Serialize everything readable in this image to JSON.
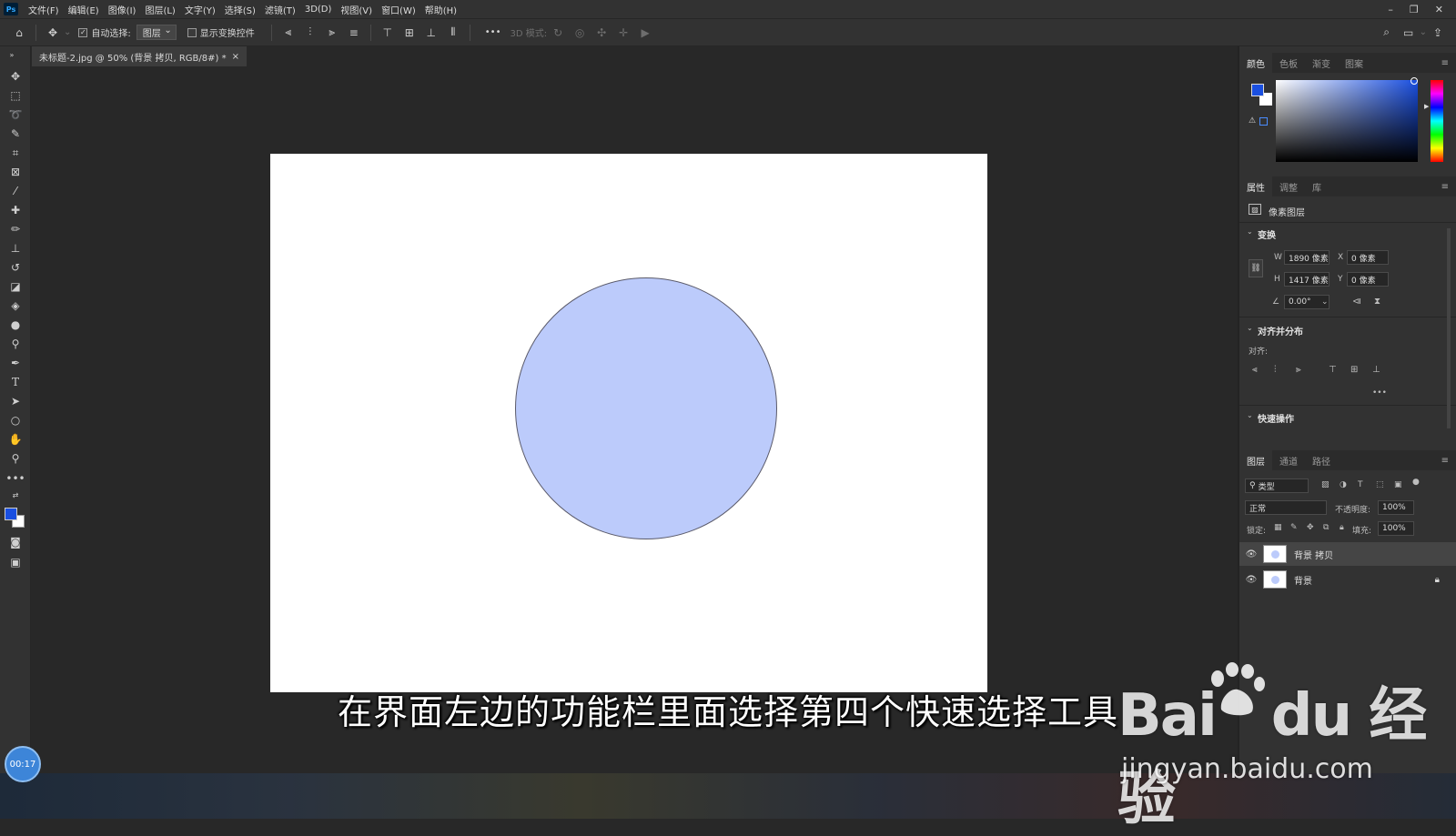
{
  "app": {
    "logo": "Ps"
  },
  "menu": [
    "文件(F)",
    "编辑(E)",
    "图像(I)",
    "图层(L)",
    "文字(Y)",
    "选择(S)",
    "滤镜(T)",
    "3D(D)",
    "视图(V)",
    "窗口(W)",
    "帮助(H)"
  ],
  "window_controls": {
    "minimize": "–",
    "restore": "❐",
    "close": "✕"
  },
  "options": {
    "auto_select_label": "自动选择:",
    "auto_select_checked": true,
    "layer_select_value": "图层",
    "show_transform_label": "显示变换控件",
    "more": "•••",
    "mode_3d_label": "3D 模式:"
  },
  "document_tab": {
    "title": "未标题-2.jpg @ 50% (背景 拷贝, RGB/8#) *",
    "close": "×"
  },
  "tools": [
    "move-tool",
    "marquee-tool",
    "lasso-tool",
    "quick-selection-tool",
    "crop-tool",
    "frame-tool",
    "eyedropper-tool",
    "healing-brush-tool",
    "brush-tool",
    "clone-stamp-tool",
    "history-brush-tool",
    "eraser-tool",
    "paint-bucket-tool",
    "blur-tool",
    "dodge-tool",
    "pen-tool",
    "type-tool",
    "path-selection-tool",
    "ellipse-tool",
    "hand-tool",
    "zoom-tool",
    "more-tools"
  ],
  "colors": {
    "foreground": "#1a4fe0",
    "background": "#ffffff",
    "shape_fill": "#bccbfb",
    "panel_bg": "#323232"
  },
  "color_panel": {
    "tabs": [
      "颜色",
      "色板",
      "渐变",
      "图案"
    ],
    "active": 0
  },
  "properties_panel": {
    "tabs": [
      "属性",
      "调整",
      "库"
    ],
    "layer_kind": "像素图层",
    "transform_heading": "变换",
    "w_label": "W",
    "w_value": "1890 像素",
    "h_label": "H",
    "h_value": "1417 像素",
    "x_label": "X",
    "x_value": "0 像素",
    "y_label": "Y",
    "y_value": "0 像素",
    "angle_value": "0.00°",
    "align_heading": "对齐并分布",
    "align_label": "对齐:",
    "more": "•••",
    "quick_actions_heading": "快速操作"
  },
  "layers_panel": {
    "tabs": [
      "图层",
      "通道",
      "路径"
    ],
    "filter_value": "类型",
    "blend_mode": "正常",
    "opacity_label": "不透明度:",
    "opacity_value": "100%",
    "lock_label": "锁定:",
    "fill_label": "填充:",
    "fill_value": "100%",
    "layers": [
      {
        "name": "背景 拷贝",
        "selected": true,
        "locked": false
      },
      {
        "name": "背景",
        "selected": false,
        "locked": true
      }
    ]
  },
  "video": {
    "timer": "00:17",
    "subtitle": "在界面左边的功能栏里面选择第四个快速选择工具"
  },
  "watermark": {
    "brand": "Bai du 经验",
    "url": "jingyan.baidu.com"
  }
}
